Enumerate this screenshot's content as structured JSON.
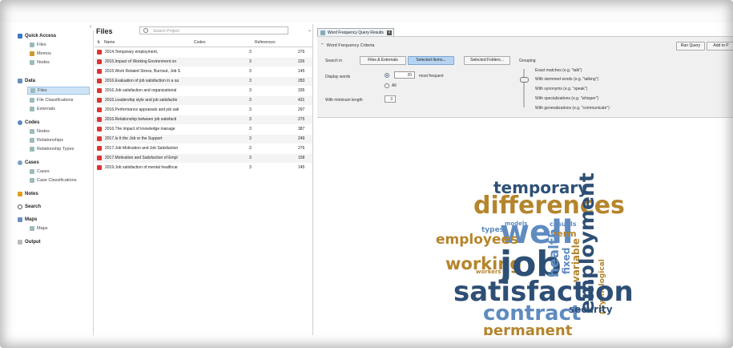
{
  "colors": {
    "dark_blue": "#2e4f75",
    "mid_blue": "#5f8bc0",
    "gold": "#b5852c",
    "selection": "#cfe3f7",
    "pdf_red": "#d33333"
  },
  "nav": {
    "quick_access": {
      "label": "Quick Access",
      "items": [
        "Files",
        "Memos",
        "Nodes"
      ]
    },
    "data": {
      "label": "Data",
      "items": [
        "Files",
        "File Classifications",
        "Externals"
      ]
    },
    "codes": {
      "label": "Codes",
      "items": [
        "Nodes",
        "Relationships",
        "Relationship Types"
      ]
    },
    "cases": {
      "label": "Cases",
      "items": [
        "Cases",
        "Case Classifications"
      ]
    },
    "notes": "Notes",
    "search": "Search",
    "maps": {
      "label": "Maps",
      "items": [
        "Maps"
      ]
    },
    "output": "Output"
  },
  "files_panel": {
    "title": "Files",
    "search_placeholder": "Search Project",
    "columns": {
      "name": "Name",
      "codes": "Codes",
      "references": "References"
    },
    "rows": [
      {
        "name": "2014.Temporary employment,",
        "codes": "3",
        "references": "276"
      },
      {
        "name": "2015.Impact of Working Environment on",
        "codes": "3",
        "references": "226"
      },
      {
        "name": "2015.Work Related Stress, Burnout, Job S",
        "codes": "3",
        "references": "145"
      },
      {
        "name": "2016.Evaluation of job satisfaction in a sa",
        "codes": "3",
        "references": "283"
      },
      {
        "name": "2016.Job satisfaction and organizational",
        "codes": "3",
        "references": "335"
      },
      {
        "name": "2016.Leadership style and job satisfactio",
        "codes": "3",
        "references": "431"
      },
      {
        "name": "2016.Performance appraisals and job sati",
        "codes": "3",
        "references": "297"
      },
      {
        "name": "2016.Relationship between job satisfacti",
        "codes": "3",
        "references": "275"
      },
      {
        "name": "2016.The impact of knowledge manage",
        "codes": "3",
        "references": "387"
      },
      {
        "name": "2017.Is It the Job or the Support",
        "codes": "3",
        "references": "249"
      },
      {
        "name": "2017.Job Motivation and Job Satisfaction",
        "codes": "3",
        "references": "276"
      },
      {
        "name": "2017.Motivation and Satisfaction of Empl",
        "codes": "3",
        "references": "158"
      },
      {
        "name": "2019.Job satisfaction of mental healthcar",
        "codes": "3",
        "references": "145"
      }
    ]
  },
  "query": {
    "tab_label": "Word Frequency Query Results",
    "criteria_title": "Word Frequency Criteria",
    "run_query": "Run Query",
    "add_to": "Add to P",
    "search_in_label": "Search in",
    "search_in_options": [
      "Files & Externals",
      "Selected Items...",
      "Selected Folders..."
    ],
    "selected_search_in": "Selected Items...",
    "display_words_label": "Display words",
    "display_count": "20",
    "most_frequent_label": "most frequent",
    "all_label": "All",
    "min_length_label": "With minimum length",
    "min_length": "3",
    "grouping_label": "Grouping",
    "grouping_options": [
      "Exact matches (e.g. \"talk\")",
      "With stemmed words (e.g. \"talking\")",
      "With synonyms (e.g. \"speak\")",
      "With specializations (e.g. \"whisper\")",
      "With generalizations (e.g. \"communicate\")"
    ],
    "grouping_level": 0.25
  },
  "word_cloud": [
    {
      "text": "temporary",
      "color": "#2e4f75"
    },
    {
      "text": "differences",
      "color": "#b5852c"
    },
    {
      "text": "employment",
      "color": "#2e4f75"
    },
    {
      "text": "models",
      "color": "#5f8bc0"
    },
    {
      "text": "types",
      "color": "#5f8bc0"
    },
    {
      "text": "well",
      "color": "#5f8bc0"
    },
    {
      "text": "casuals",
      "color": "#5f8bc0"
    },
    {
      "text": "term",
      "color": "#b5852c"
    },
    {
      "text": "employees",
      "color": "#b5852c"
    },
    {
      "text": "working",
      "color": "#b5852c"
    },
    {
      "text": "workers",
      "color": "#b5852c"
    },
    {
      "text": "job",
      "color": "#2e4f75"
    },
    {
      "text": "health",
      "color": "#5f8bc0"
    },
    {
      "text": "fixed",
      "color": "#5f8bc0"
    },
    {
      "text": "variable",
      "color": "#b5852c"
    },
    {
      "text": "psychological",
      "color": "#b5852c"
    },
    {
      "text": "satisfaction",
      "color": "#2e4f75"
    },
    {
      "text": "contract",
      "color": "#5f8bc0"
    },
    {
      "text": "security",
      "color": "#2e4f75"
    },
    {
      "text": "permanent",
      "color": "#b5852c"
    }
  ]
}
